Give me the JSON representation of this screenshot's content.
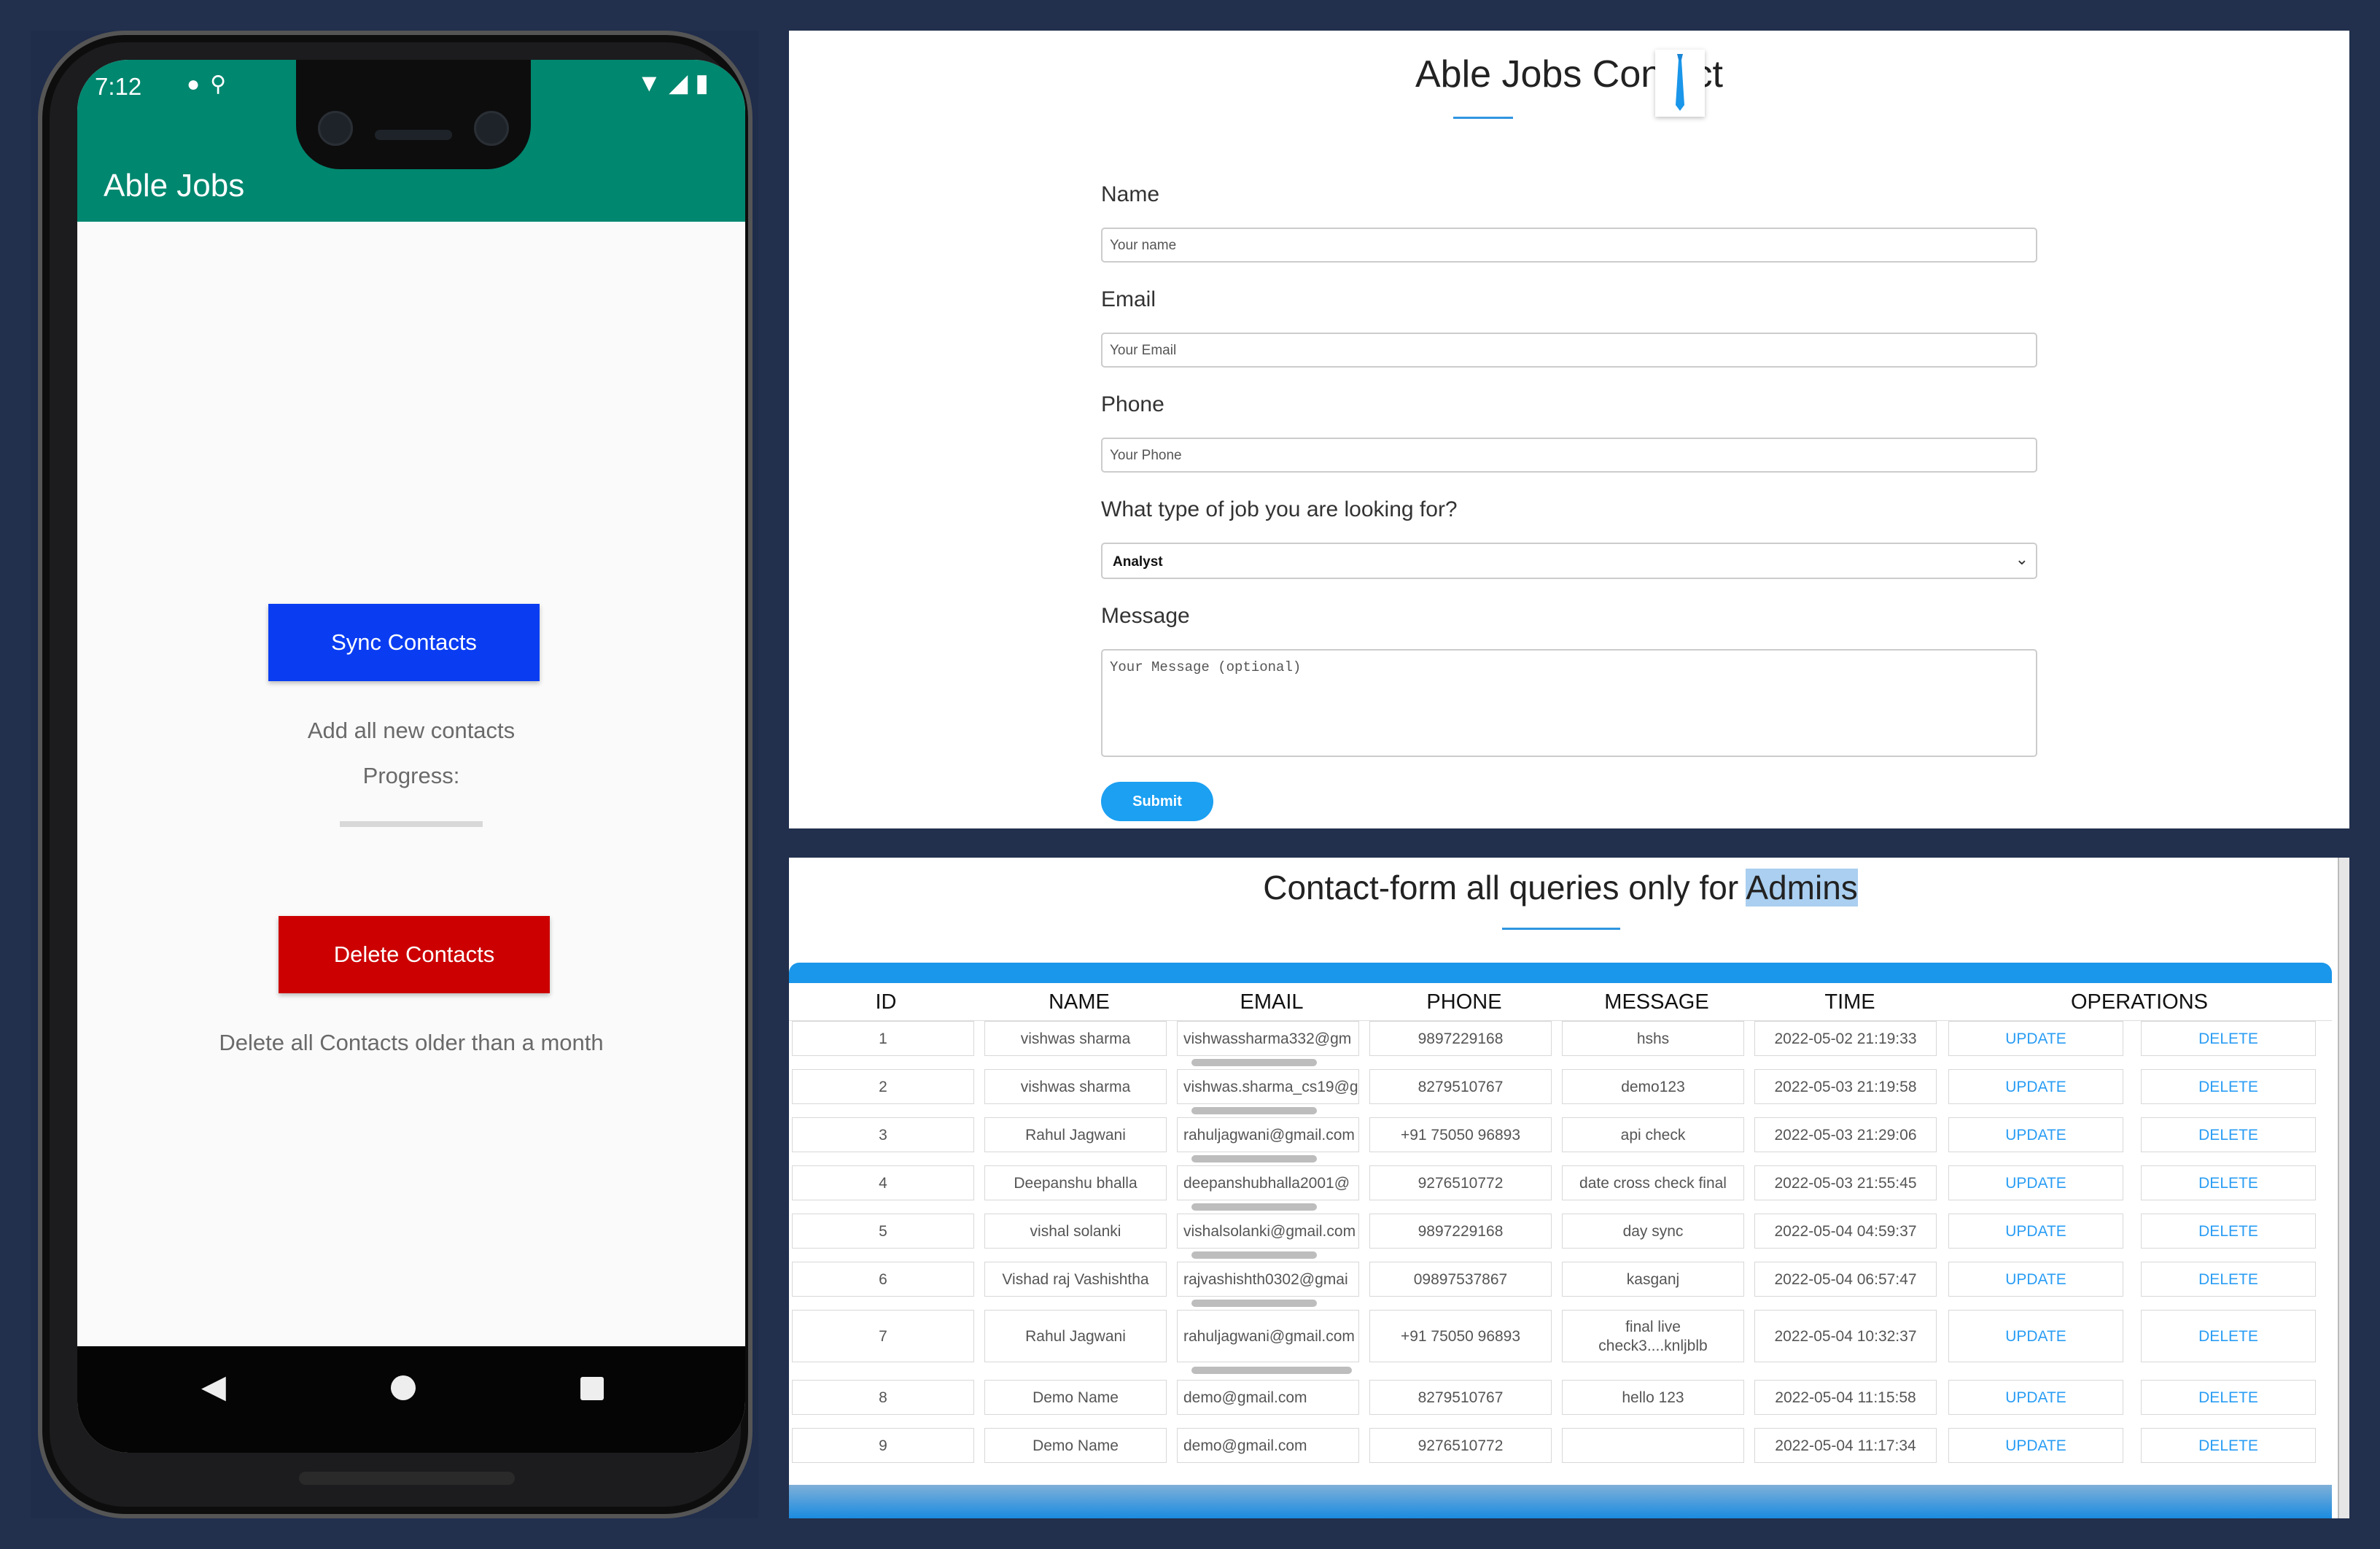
{
  "phone": {
    "status_time": "7:12",
    "app_title": "Able Jobs",
    "sync_button": "Sync Contacts",
    "add_text": "Add all new contacts",
    "progress_label": "Progress:",
    "progress_value": 0,
    "delete_button": "Delete Contacts",
    "delete_text": "Delete all Contacts older than a month",
    "status_icons_left": [
      "message-icon",
      "location-icon"
    ],
    "status_icons_right": [
      "wifi-icon",
      "signal-icon",
      "battery-icon"
    ],
    "nav_icons": [
      "back-icon",
      "home-icon",
      "recents-icon"
    ],
    "colors": {
      "appbar": "#00876f",
      "sync": "#0a3df2",
      "delete": "#cc0000"
    }
  },
  "form": {
    "title": "Able Jobs Contact",
    "name_label": "Name",
    "name_placeholder": "Your name",
    "email_label": "Email",
    "email_placeholder": "Your Email",
    "phone_label": "Phone",
    "phone_placeholder": "Your Phone",
    "job_label": "What type of job you are looking for?",
    "job_selected": "Analyst",
    "message_label": "Message",
    "message_placeholder": "Your Message (optional)",
    "submit": "Submit",
    "logo_icon": "necktie-icon",
    "accent": "#1ba0f2"
  },
  "admin": {
    "title_pre": "Contact-form all queries only for ",
    "title_highlight": "Admins",
    "columns": [
      "ID",
      "NAME",
      "EMAIL",
      "PHONE",
      "MESSAGE",
      "TIME",
      "OPERATIONS"
    ],
    "update_label": "UPDATE",
    "delete_label": "DELETE",
    "rows": [
      {
        "id": "1",
        "name": "vishwas sharma",
        "email": "vishwassharma332@gm",
        "phone": "9897229168",
        "message": "hshs",
        "time": "2022-05-02 21:19:33"
      },
      {
        "id": "2",
        "name": "vishwas sharma",
        "email": "vishwas.sharma_cs19@g",
        "phone": "8279510767",
        "message": "demo123",
        "time": "2022-05-03 21:19:58"
      },
      {
        "id": "3",
        "name": "Rahul Jagwani",
        "email": "rahuljagwani@gmail.com",
        "phone": "+91 75050 96893",
        "message": "api check",
        "time": "2022-05-03 21:29:06"
      },
      {
        "id": "4",
        "name": "Deepanshu bhalla",
        "email": "deepanshubhalla2001@",
        "phone": "9276510772",
        "message": "date cross check final",
        "time": "2022-05-03 21:55:45"
      },
      {
        "id": "5",
        "name": "vishal solanki",
        "email": "vishalsolanki@gmail.com",
        "phone": "9897229168",
        "message": "day sync",
        "time": "2022-05-04 04:59:37"
      },
      {
        "id": "6",
        "name": "Vishad raj Vashishtha",
        "email": "rajvashishth0302@gmai",
        "phone": "09897537867",
        "message": "kasganj",
        "time": "2022-05-04 06:57:47"
      },
      {
        "id": "7",
        "name": "Rahul Jagwani",
        "email": "rahuljagwani@gmail.com",
        "phone": "+91 75050 96893",
        "message_line1": "final live",
        "message_line2": "check3....knljblb",
        "time": "2022-05-04 10:32:37"
      },
      {
        "id": "8",
        "name": "Demo Name",
        "email": "demo@gmail.com",
        "phone": "8279510767",
        "message": "hello 123",
        "time": "2022-05-04 11:15:58"
      },
      {
        "id": "9",
        "name": "Demo Name",
        "email": "demo@gmail.com",
        "phone": "9276510772",
        "message": "",
        "time": "2022-05-04 11:17:34"
      }
    ]
  }
}
